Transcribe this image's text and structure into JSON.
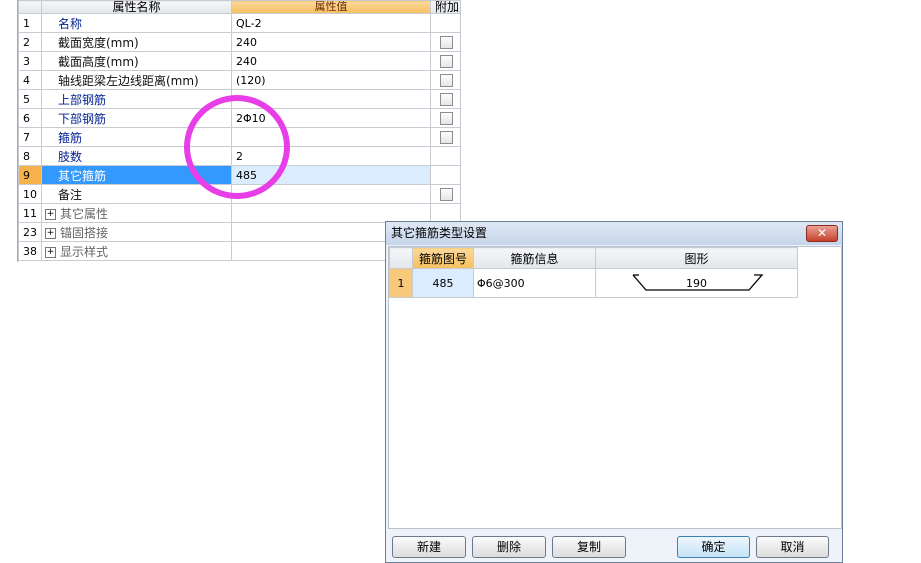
{
  "grid": {
    "headers": {
      "name": "属性名称",
      "value": "属性值",
      "extra": "附加"
    },
    "rows": [
      {
        "num": "1",
        "name": "名称",
        "value": "QL-2",
        "color": "blue",
        "checkbox": false
      },
      {
        "num": "2",
        "name": "截面宽度(mm)",
        "value": "240",
        "color": "black",
        "checkbox": true
      },
      {
        "num": "3",
        "name": "截面高度(mm)",
        "value": "240",
        "color": "black",
        "checkbox": true
      },
      {
        "num": "4",
        "name": "轴线距梁左边线距离(mm)",
        "value": "(120)",
        "color": "black",
        "checkbox": true
      },
      {
        "num": "5",
        "name": "上部钢筋",
        "value": "",
        "color": "blue",
        "checkbox": true
      },
      {
        "num": "6",
        "name": "下部钢筋",
        "value": "2Φ10",
        "color": "blue",
        "checkbox": true
      },
      {
        "num": "7",
        "name": "箍筋",
        "value": "",
        "color": "blue",
        "checkbox": true
      },
      {
        "num": "8",
        "name": "肢数",
        "value": "2",
        "color": "blue",
        "checkbox": false
      },
      {
        "num": "9",
        "name": "其它箍筋",
        "value": "485",
        "color": "blue",
        "checkbox": false,
        "selected": true
      },
      {
        "num": "10",
        "name": "备注",
        "value": "",
        "color": "black",
        "checkbox": true
      },
      {
        "num": "11",
        "name": "其它属性",
        "value": "",
        "color": "gray",
        "expand": "+"
      },
      {
        "num": "23",
        "name": "锚固搭接",
        "value": "",
        "color": "gray",
        "expand": "+"
      },
      {
        "num": "38",
        "name": "显示样式",
        "value": "",
        "color": "gray",
        "expand": "+"
      }
    ]
  },
  "dialog": {
    "title": "其它箍筋类型设置",
    "close_label": "✕",
    "columns": [
      "箍筋图号",
      "箍筋信息",
      "图形"
    ],
    "rows": [
      {
        "num": "1",
        "code": "485",
        "info": "Φ6@300",
        "shape_value": "190"
      }
    ],
    "buttons": {
      "new": "新建",
      "delete": "删除",
      "copy": "复制",
      "ok": "确定",
      "cancel": "取消"
    }
  }
}
